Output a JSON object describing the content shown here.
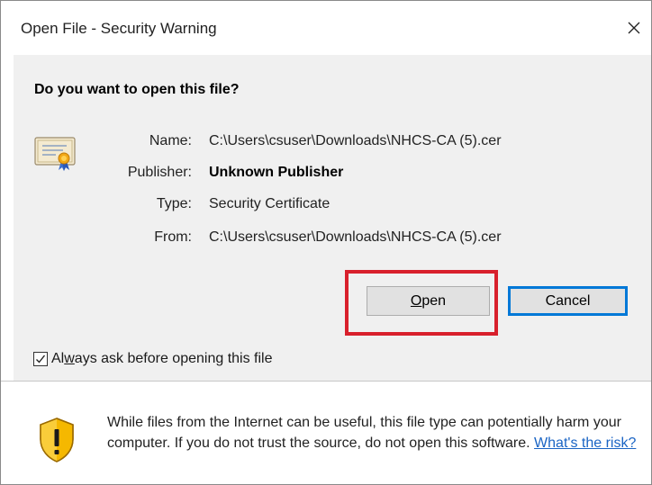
{
  "window": {
    "title": "Open File - Security Warning",
    "close_glyph": "✕"
  },
  "prompt": {
    "question": "Do you want to open this file?"
  },
  "file_info": {
    "name_label": "Name:",
    "name_value": "C:\\Users\\csuser\\Downloads\\NHCS-CA (5).cer",
    "publisher_label": "Publisher:",
    "publisher_value": "Unknown Publisher",
    "type_label": "Type:",
    "type_value": "Security Certificate",
    "from_label": "From:",
    "from_value": "C:\\Users\\csuser\\Downloads\\NHCS-CA (5).cer"
  },
  "buttons": {
    "open_accel": "O",
    "open_rest": "pen",
    "cancel_label": "Cancel"
  },
  "always_ask": {
    "checked": true,
    "label_pre": "Al",
    "label_accel": "w",
    "label_post": "ays ask before opening this file"
  },
  "warning": {
    "text": "While files from the Internet can be useful, this file type can potentially harm your computer. If you do not trust the source, do not open this software. ",
    "link_text": "What's the risk?"
  },
  "icons": {
    "certificate": "certificate-icon",
    "shield": "security-shield-icon",
    "close": "close-icon",
    "checkmark": "checkmark-icon"
  },
  "colors": {
    "highlight": "#d8202c",
    "focus_border": "#0078d7",
    "link": "#1a64c4",
    "panel_bg": "#f0f0f0"
  }
}
